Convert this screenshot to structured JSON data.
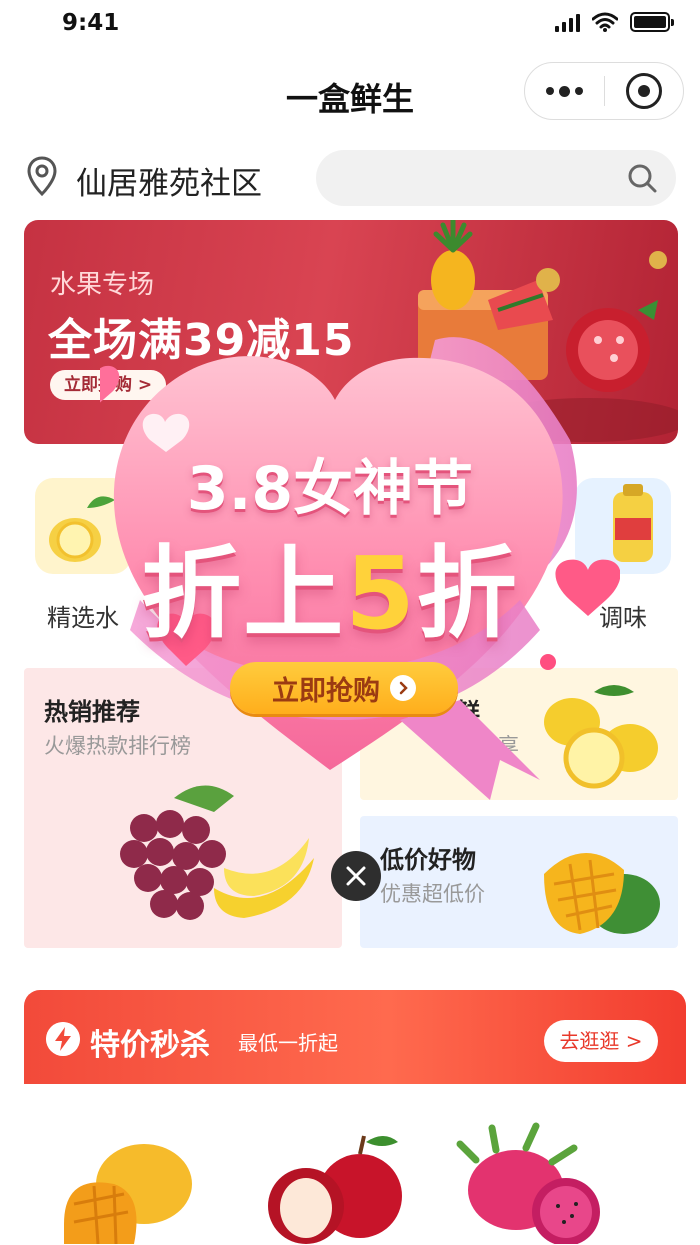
{
  "status": {
    "time": "9:41"
  },
  "nav": {
    "title": "一盒鲜生"
  },
  "location": {
    "name": "仙居雅苑社区"
  },
  "banner": {
    "subtitle": "水果专场",
    "title": "全场满39减15",
    "button": "立即抢购 >"
  },
  "categories": [
    {
      "label": "精选水"
    },
    {
      "label": "调味"
    }
  ],
  "cards": {
    "hot": {
      "title": "热销推荐",
      "subtitle": "火爆热款排行榜"
    },
    "fresh": {
      "title": "鲜",
      "subtitle": "提前享"
    },
    "cheap": {
      "title": "低价好物",
      "subtitle": "优惠超低价"
    }
  },
  "flash": {
    "title": "特价秒杀",
    "subtitle": "最低一折起",
    "button": "去逛逛 >"
  },
  "popup": {
    "line1": "3.8女神节",
    "line2_prefix": "折上",
    "line2_number": "5",
    "line2_suffix": "折",
    "button": "立即抢购"
  },
  "colors": {
    "accent": "#e8382a",
    "brand_red": "#c53242",
    "popup_pink": "#f77aa0",
    "popup_yellow": "#ffd23a"
  }
}
